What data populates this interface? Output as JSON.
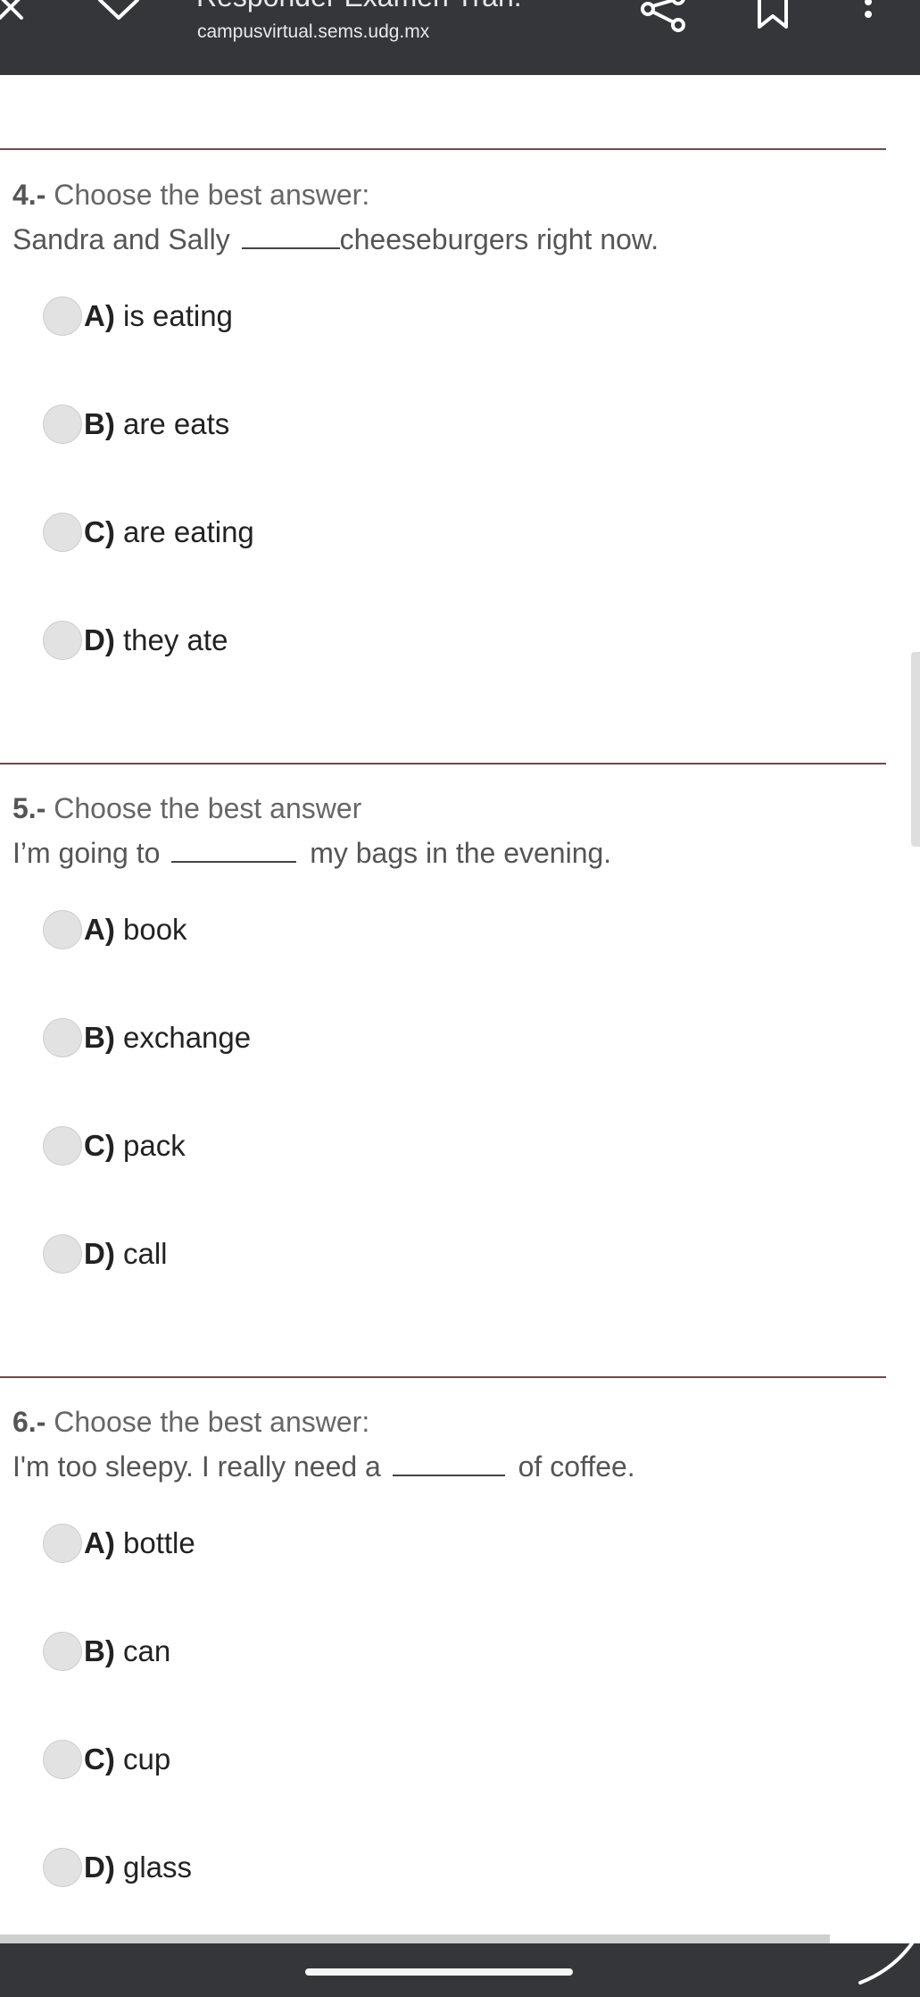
{
  "browser": {
    "title": "Responder Examen Trán.",
    "url": "campusvirtual.sems.udg.mx"
  },
  "questions": [
    {
      "number": "4.-",
      "instruction": "Choose the best answer:",
      "text_before": "Sandra and Sally",
      "text_after": "cheeseburgers right now.",
      "options": [
        {
          "letter": "A)",
          "text": "is eating"
        },
        {
          "letter": "B)",
          "text": "are eats"
        },
        {
          "letter": "C)",
          "text": "are eating"
        },
        {
          "letter": "D)",
          "text": "they ate"
        }
      ]
    },
    {
      "number": "5.-",
      "instruction": "Choose the best answer",
      "text_before": "I’m going to",
      "text_after": "my bags in the evening.",
      "options": [
        {
          "letter": "A)",
          "text": "book"
        },
        {
          "letter": "B)",
          "text": "exchange"
        },
        {
          "letter": "C)",
          "text": "pack"
        },
        {
          "letter": "D)",
          "text": "call"
        }
      ]
    },
    {
      "number": "6.-",
      "instruction": "Choose the best answer:",
      "text_before": "I'm too sleepy. I really need a",
      "text_after": "of coffee.",
      "options": [
        {
          "letter": "A)",
          "text": "bottle"
        },
        {
          "letter": "B)",
          "text": "can"
        },
        {
          "letter": "C)",
          "text": "cup"
        },
        {
          "letter": "D)",
          "text": "glass"
        }
      ]
    }
  ]
}
